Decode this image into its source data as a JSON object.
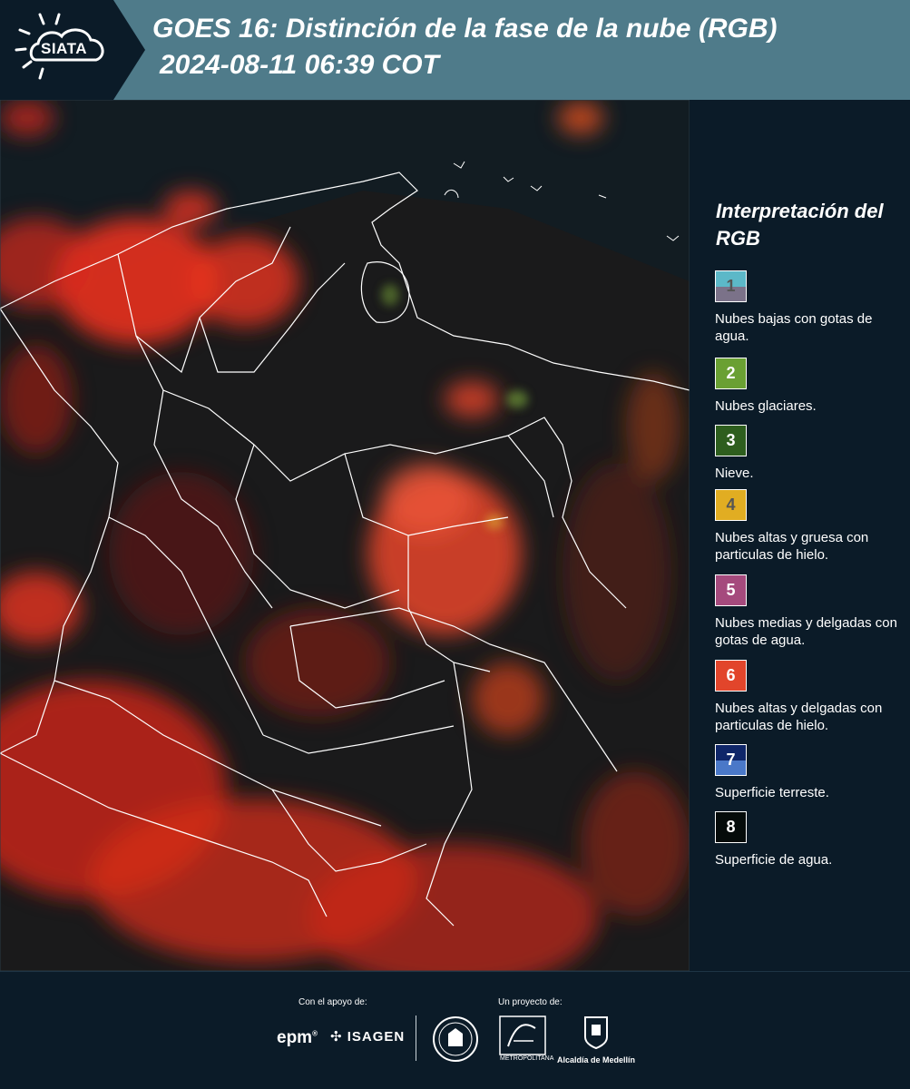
{
  "header": {
    "logo_text": "SIATA",
    "title": "GOES 16: Distinción de la fase de la nube (RGB)",
    "datetime": "2024-08-11 06:39 COT"
  },
  "colors": {
    "header_bg": "#4f7b8a",
    "panel_bg": "#0b1b28",
    "cloud_red": "#e8321e",
    "border_line": "#ffffff"
  },
  "legend": {
    "title": "Interpretación del RGB",
    "items": [
      {
        "number": "1",
        "label": "Nubes bajas con gotas de agua.",
        "color_top": "#5cb8c8",
        "color_bottom": "#7b7289",
        "text_color": "#555555"
      },
      {
        "number": "2",
        "label": "Nubes glaciares.",
        "color_top": "#6aa033",
        "color_bottom": "#6aa033",
        "text_color": "#ffffff"
      },
      {
        "number": "3",
        "label": "Nieve.",
        "color_top": "#2e5e1e",
        "color_bottom": "#2e5e1e",
        "text_color": "#ffffff"
      },
      {
        "number": "4",
        "label": "Nubes altas y gruesa con particulas de hielo.",
        "color_top": "#e1ad22",
        "color_bottom": "#e1ad22",
        "text_color": "#555555"
      },
      {
        "number": "5",
        "label": "Nubes medias y delgadas con gotas de agua.",
        "color_top": "#a54a7d",
        "color_bottom": "#a54a7d",
        "text_color": "#ffffff"
      },
      {
        "number": "6",
        "label": "Nubes altas y delgadas con particulas de hielo.",
        "color_top": "#e2452b",
        "color_bottom": "#e2452b",
        "text_color": "#ffffff"
      },
      {
        "number": "7",
        "label": "Superficie terreste.",
        "color_top": "#0f2669",
        "color_bottom": "#4a78c8",
        "text_color": "#ffffff"
      },
      {
        "number": "8",
        "label": "Superficie de agua.",
        "color_top": "#050b0a",
        "color_bottom": "#050b0a",
        "text_color": "#ffffff"
      }
    ]
  },
  "footer": {
    "support_label": "Con el apoyo de:",
    "project_label": "Un proyecto de:",
    "epm": "epm",
    "isagen": "ISAGEN",
    "area_text": "METROPOLITANA",
    "alcaldia": "Alcaldía de Medellín"
  }
}
